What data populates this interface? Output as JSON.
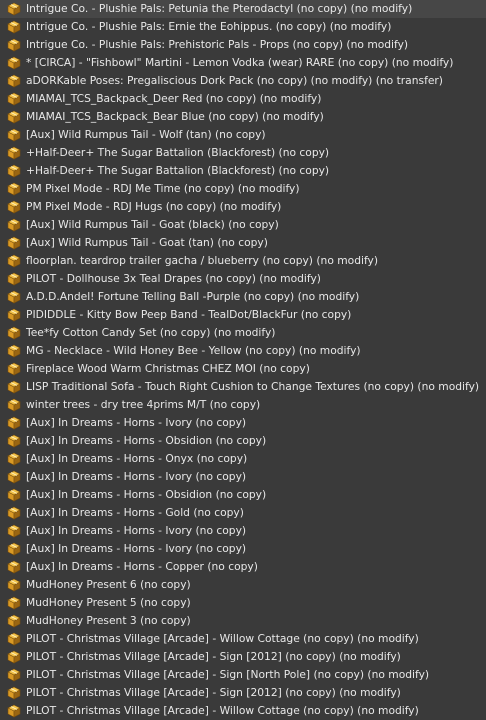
{
  "inventory": {
    "items": [
      {
        "label": "Intrigue Co. - Plushie Pals: Petunia the Pterodactyl (no copy) (no modify)",
        "icon": "object-box-icon"
      },
      {
        "label": "Intrigue Co. - Plushie Pals: Ernie the Eohippus. (no copy) (no modify)",
        "icon": "object-box-icon"
      },
      {
        "label": "Intrigue Co. - Plushie Pals: Prehistoric Pals - Props (no copy) (no modify)",
        "icon": "object-box-icon"
      },
      {
        "label": "* [CIRCA] - \"Fishbowl\" Martini - Lemon Vodka (wear) RARE (no copy) (no modify)",
        "icon": "object-box-icon"
      },
      {
        "label": "aDORKable Poses: Pregaliscious Dork Pack (no copy) (no modify) (no transfer)",
        "icon": "object-box-icon"
      },
      {
        "label": "MIAMAI_TCS_Backpack_Deer Red (no copy) (no modify)",
        "icon": "object-box-icon"
      },
      {
        "label": "MIAMAI_TCS_Backpack_Bear Blue (no copy) (no modify)",
        "icon": "object-box-icon"
      },
      {
        "label": "[Aux] Wild Rumpus Tail - Wolf (tan) (no copy)",
        "icon": "object-box-icon"
      },
      {
        "label": "+Half-Deer+ The Sugar Battalion (Blackforest) (no copy)",
        "icon": "object-box-icon"
      },
      {
        "label": "+Half-Deer+ The Sugar Battalion (Blackforest) (no copy)",
        "icon": "object-box-icon"
      },
      {
        "label": "PM Pixel Mode - RDJ Me Time (no copy) (no modify)",
        "icon": "object-box-icon"
      },
      {
        "label": "PM Pixel Mode - RDJ Hugs (no copy) (no modify)",
        "icon": "object-box-icon"
      },
      {
        "label": "[Aux] Wild Rumpus Tail - Goat (black) (no copy)",
        "icon": "object-box-icon"
      },
      {
        "label": "[Aux] Wild Rumpus Tail - Goat (tan) (no copy)",
        "icon": "object-box-icon"
      },
      {
        "label": "floorplan. teardrop trailer gacha / blueberry (no copy) (no modify)",
        "icon": "object-box-icon"
      },
      {
        "label": "PILOT -  Dollhouse 3x Teal Drapes (no copy) (no modify)",
        "icon": "object-box-icon"
      },
      {
        "label": "A.D.D.Andel! Fortune Telling Ball -Purple (no copy) (no modify)",
        "icon": "object-box-icon"
      },
      {
        "label": "PIDIDDLE - Kitty Bow Peep Band - TealDot/BlackFur (no copy)",
        "icon": "object-box-icon"
      },
      {
        "label": "Tee*fy Cotton Candy Set (no copy) (no modify)",
        "icon": "object-box-icon"
      },
      {
        "label": "MG - Necklace - Wild Honey Bee - Yellow (no copy) (no modify)",
        "icon": "object-box-icon"
      },
      {
        "label": "Fireplace Wood Warm Christmas CHEZ MOI (no copy)",
        "icon": "object-box-icon"
      },
      {
        "label": "LISP Traditional Sofa - Touch Right Cushion to Change Textures (no copy) (no modify)",
        "icon": "object-box-icon"
      },
      {
        "label": "winter trees - dry tree 4prims M/T (no copy)",
        "icon": "object-box-icon"
      },
      {
        "label": "[Aux] In Dreams - Horns - Ivory (no copy)",
        "icon": "object-box-icon"
      },
      {
        "label": "[Aux] In Dreams - Horns - Obsidion (no copy)",
        "icon": "object-box-icon"
      },
      {
        "label": "[Aux] In Dreams - Horns - Onyx (no copy)",
        "icon": "object-box-icon"
      },
      {
        "label": "[Aux] In Dreams - Horns - Ivory (no copy)",
        "icon": "object-box-icon"
      },
      {
        "label": "[Aux] In Dreams - Horns - Obsidion (no copy)",
        "icon": "object-box-icon"
      },
      {
        "label": "[Aux] In Dreams - Horns - Gold (no copy)",
        "icon": "object-box-icon"
      },
      {
        "label": "[Aux] In Dreams - Horns - Ivory (no copy)",
        "icon": "object-box-icon"
      },
      {
        "label": "[Aux] In Dreams - Horns - Ivory (no copy)",
        "icon": "object-box-icon"
      },
      {
        "label": "[Aux] In Dreams - Horns - Copper (no copy)",
        "icon": "object-box-icon"
      },
      {
        "label": "MudHoney Present 6 (no copy)",
        "icon": "object-box-icon"
      },
      {
        "label": "MudHoney Present 5 (no copy)",
        "icon": "object-box-icon"
      },
      {
        "label": "MudHoney Present 3 (no copy)",
        "icon": "object-box-icon"
      },
      {
        "label": "PILOT - Christmas Village [Arcade] - Willow Cottage (no copy) (no modify)",
        "icon": "object-box-icon"
      },
      {
        "label": "PILOT - Christmas Village [Arcade] - Sign [2012] (no copy) (no modify)",
        "icon": "object-box-icon"
      },
      {
        "label": "PILOT - Christmas Village [Arcade] - Sign [North Pole] (no copy) (no modify)",
        "icon": "object-box-icon"
      },
      {
        "label": "PILOT - Christmas Village [Arcade] - Sign [2012] (no copy) (no modify)",
        "icon": "object-box-icon"
      },
      {
        "label": "PILOT - Christmas Village [Arcade] - Willow Cottage (no copy) (no modify)",
        "icon": "object-box-icon"
      }
    ]
  },
  "colors": {
    "background": "#3a3a3a",
    "text": "#e8e8e8",
    "icon_light": "#f2c24a",
    "icon_mid": "#d99a25",
    "icon_dark": "#9a6612"
  }
}
